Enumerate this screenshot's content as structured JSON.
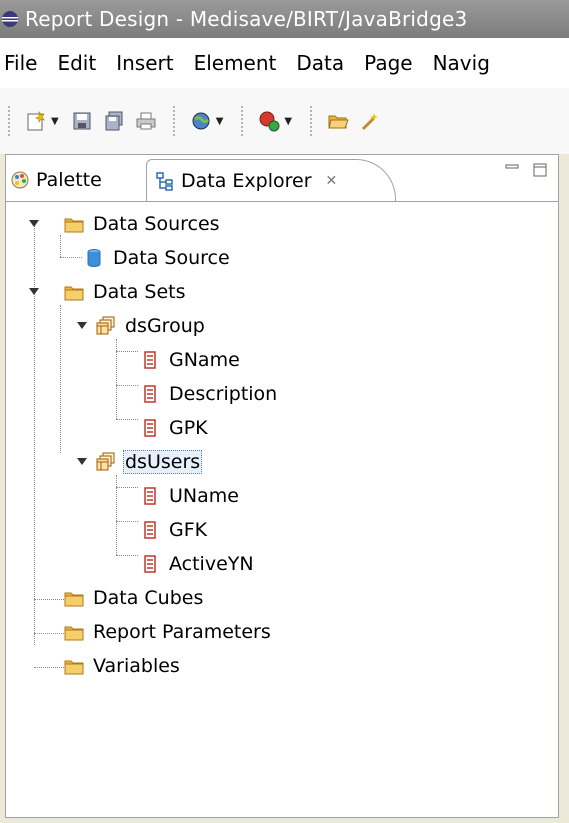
{
  "window": {
    "title": "Report Design - Medisave/BIRT/JavaBridge3"
  },
  "menu": [
    "File",
    "Edit",
    "Insert",
    "Element",
    "Data",
    "Page",
    "Navig"
  ],
  "toolbar": {
    "buttons": [
      "new-report-icon",
      "save-icon",
      "save-all-icon",
      "print-icon",
      "web-browser-icon",
      "run-icon",
      "open-folder-icon",
      "wand-icon"
    ]
  },
  "tabs": {
    "palette": "Palette",
    "data_explorer": "Data Explorer"
  },
  "tree": {
    "data_sources": "Data Sources",
    "data_source": "Data Source",
    "data_sets": "Data Sets",
    "ds_group": "dsGroup",
    "ds_group_columns": [
      "GName",
      "Description",
      "GPK"
    ],
    "ds_users": "dsUsers",
    "ds_users_columns": [
      "UName",
      "GFK",
      "ActiveYN"
    ],
    "data_cubes": "Data Cubes",
    "report_parameters": "Report Parameters",
    "variables": "Variables"
  },
  "colors": {
    "selection": "#e6f0fb",
    "folder": "#f0b43c",
    "column_icon": "#c0392b"
  }
}
